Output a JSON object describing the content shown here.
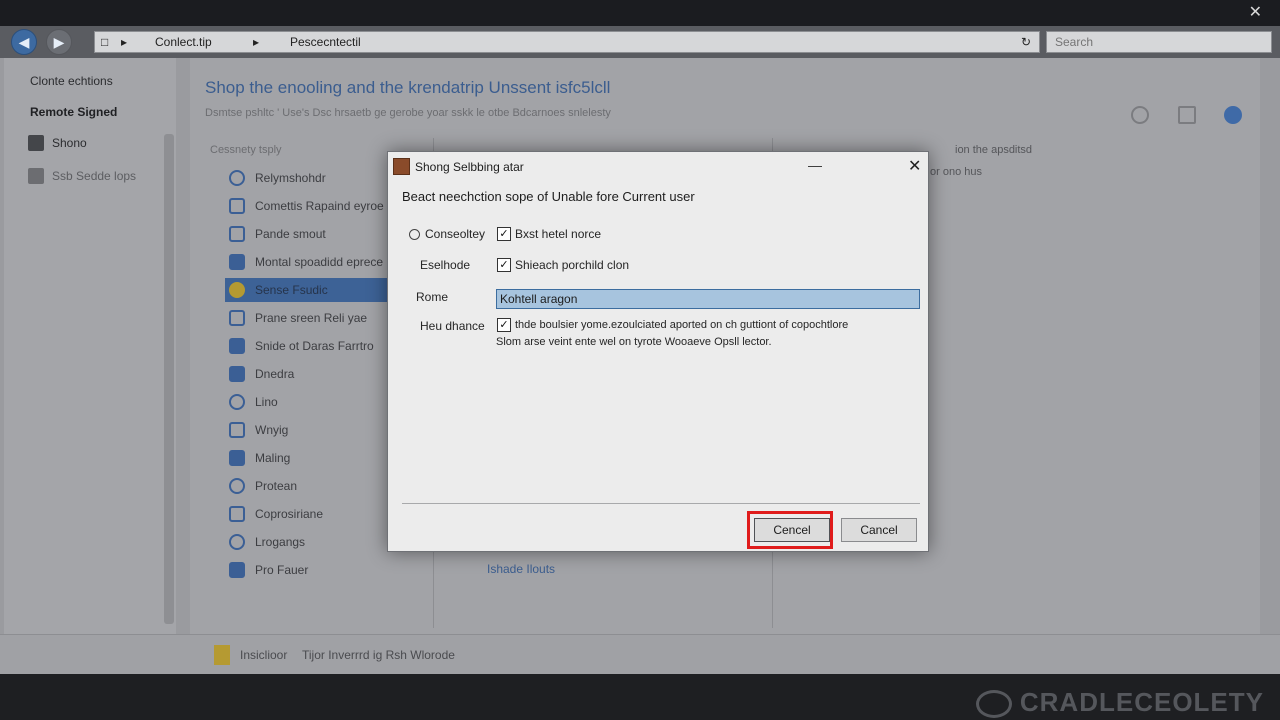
{
  "titlebar": {
    "close_glyph": "✕"
  },
  "addressbar": {
    "breadcrumb_1": "Conlect.tip",
    "breadcrumb_2": "Pescecntectil",
    "search_placeholder": "Search"
  },
  "sidebar": {
    "items": [
      {
        "label": "Clonte echtions"
      },
      {
        "label": "Remote Signed"
      },
      {
        "label": "Shono"
      },
      {
        "label": "Ssb Sedde lops"
      }
    ]
  },
  "main": {
    "title": "Shop the enooling and the krendatrip Unssent isfc5lcll",
    "subtitle": "Dsmtse pshltc ' Use's Dsc hrsaetb ge gerobe yoar sskk le otbe Bdcarnoes snlelesty",
    "list_header": "Cessnety tsply",
    "list_items": [
      {
        "label": "Relymshohdr"
      },
      {
        "label": "Comettis Rapaind eyroe"
      },
      {
        "label": "Pande smout"
      },
      {
        "label": "Montal spoadidd eprece"
      },
      {
        "label": "Sense Fsudic"
      },
      {
        "label": "Prane sreen Reli yae"
      },
      {
        "label": "Snide ot Daras Farrtro"
      },
      {
        "label": "Dnedra"
      },
      {
        "label": "Lino"
      },
      {
        "label": "Wnyig"
      },
      {
        "label": "Maling"
      },
      {
        "label": "Protean"
      },
      {
        "label": "Coprosiriane"
      },
      {
        "label": "Lrogangs"
      },
      {
        "label": "Pro Fauer"
      }
    ],
    "right_text_1": "ion the apsditsd",
    "right_text_2": "or ono hus",
    "link_text": "Ishade Ilouts"
  },
  "statusbar": {
    "item_1": "Insiclioor",
    "item_2": "Tijor Inverrrd ig Rsh Wlorode"
  },
  "watermark": "CRADLECEOLETY",
  "dialog": {
    "title": "Shong Selbbing atar",
    "heading": "Beact neechction sope of Unable fore Current user",
    "fields": [
      {
        "label": "Conseoltey",
        "check_label": "Bxst hetel norce",
        "checked": "✓"
      },
      {
        "label": "Eselhode",
        "check_label": "Shieach porchild clon",
        "checked": "✓"
      },
      {
        "label": "Rome",
        "input_value": "Kohtell aragon"
      },
      {
        "label": "Heu dhance",
        "check_label": "thde boulsier yome.ezoulciated aported on ch guttiont of copochtlore",
        "checked": "✓",
        "desc_2": "Slom arse veint ente wel on tyrote Wooaeve Opsll lector."
      }
    ],
    "buttons": {
      "primary": "Cencel",
      "secondary": "Cancel"
    },
    "minimize_glyph": "—",
    "close_glyph": "✕"
  }
}
